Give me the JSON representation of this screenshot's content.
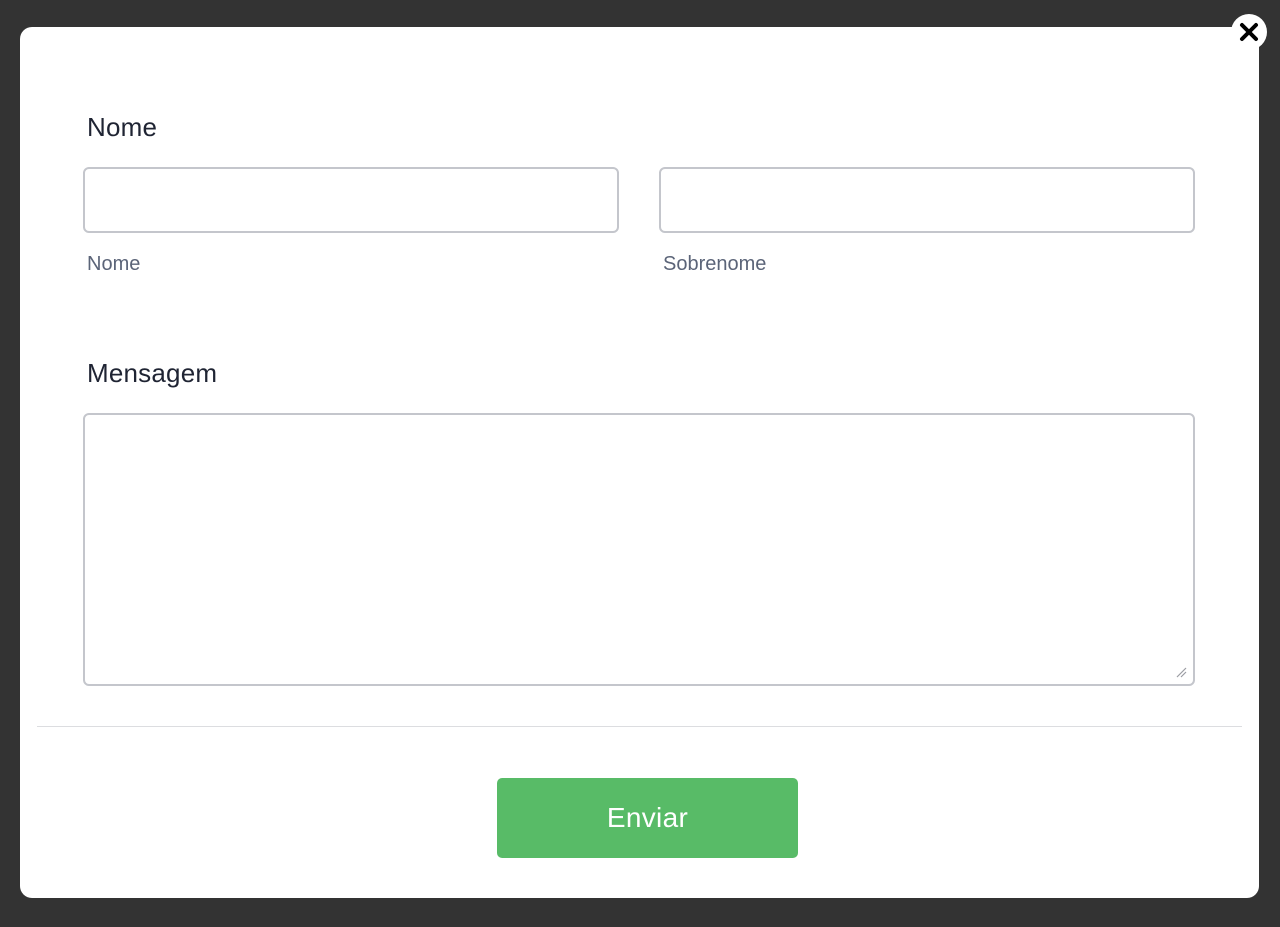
{
  "form": {
    "name_section_label": "Nome",
    "first_name": {
      "value": "",
      "placeholder": "",
      "sublabel": "Nome"
    },
    "last_name": {
      "value": "",
      "placeholder": "",
      "sublabel": "Sobrenome"
    },
    "message_section_label": "Mensagem",
    "message": {
      "value": "",
      "placeholder": ""
    },
    "submit_label": "Enviar"
  },
  "colors": {
    "backdrop": "#333333",
    "submit_button": "#58bb67"
  },
  "icons": {
    "close": "close-icon",
    "resize": "resize-grip-icon"
  }
}
